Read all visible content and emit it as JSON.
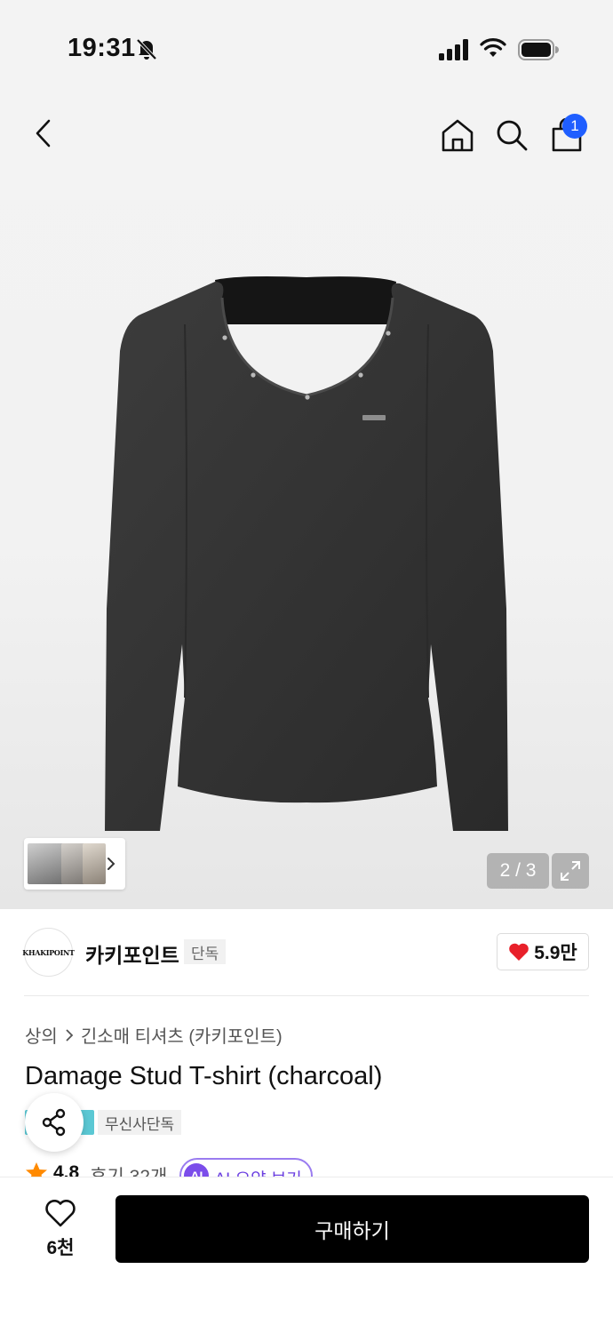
{
  "status_bar": {
    "time": "19:31"
  },
  "header": {
    "icons": [
      "chevron-left-icon",
      "home-icon",
      "search-icon",
      "shopping-bag-icon"
    ],
    "cart_badge": "1"
  },
  "gallery": {
    "page_counter": "2 / 3",
    "current_index": 2,
    "total": 3
  },
  "brand": {
    "logo_text": "KHAKIPOINT",
    "name": "카키포인트",
    "tag": "단독",
    "like_count": "5.9만"
  },
  "product": {
    "breadcrumb": [
      "상의",
      "긴소매 티셔츠 (카키포인트)"
    ],
    "title": "Damage Stud T-shirt (charcoal)",
    "tags": [
      "무신사단독"
    ],
    "rating": "4.8",
    "review_label": "후기 32개",
    "ai_badge": "AI",
    "ai_summary_label": "AI 요약 보기"
  },
  "bottom_bar": {
    "wish_count": "6천",
    "buy_label": "구매하기"
  },
  "colors": {
    "accent_blue": "#1f5eff",
    "heart_red": "#e8202a",
    "star_orange": "#ff8a00",
    "ai_purple": "#7b4dea",
    "tag_cyan": "#5bc8d4"
  }
}
